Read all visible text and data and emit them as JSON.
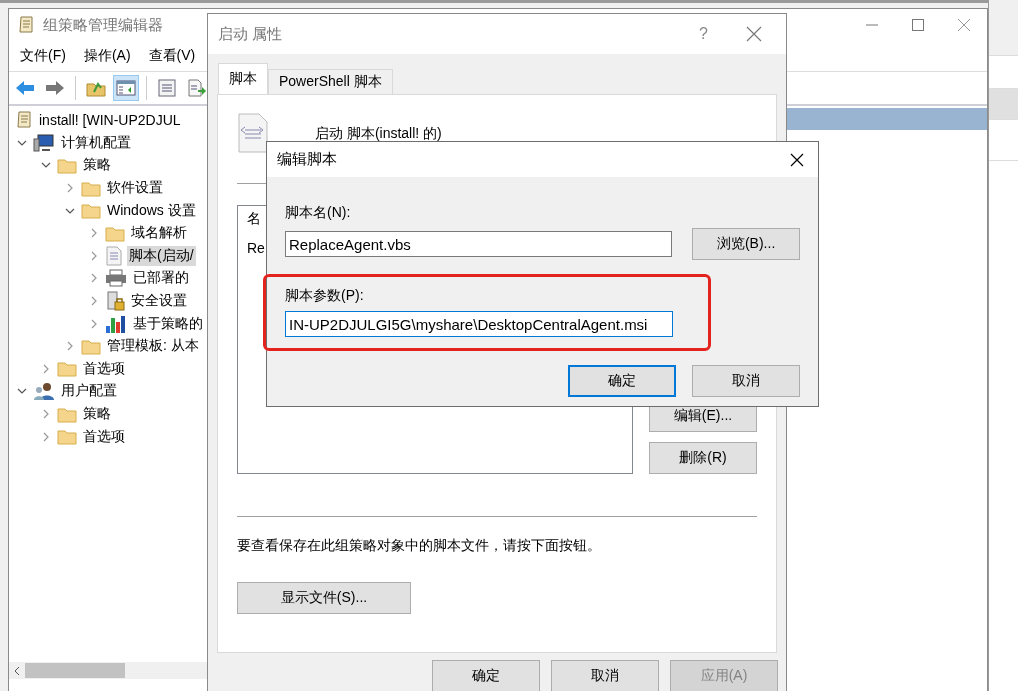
{
  "main_window": {
    "title": "组策略管理编辑器",
    "menu": [
      {
        "label": "文件(F)"
      },
      {
        "label": "操作(A)"
      },
      {
        "label": "查看(V)"
      }
    ],
    "toolbar": [
      {
        "kind": "back",
        "selected": false
      },
      {
        "kind": "forward",
        "selected": false
      },
      {
        "kind": "up",
        "selected": false
      },
      {
        "kind": "tree",
        "selected": true
      },
      {
        "kind": "properties",
        "selected": false
      },
      {
        "kind": "export",
        "selected": false
      }
    ],
    "tree": [
      {
        "label": "install!  [WIN-UP2DJUL",
        "kind": "gpo",
        "selected": false,
        "children": [
          {
            "label": "计算机配置",
            "kind": "computer",
            "selected": false,
            "expanded": true,
            "children": [
              {
                "label": "策略",
                "kind": "folder",
                "selected": false,
                "expanded": true,
                "children": [
                  {
                    "label": "软件设置",
                    "kind": "folder",
                    "selected": false,
                    "expanded": false
                  },
                  {
                    "label": "Windows 设置",
                    "kind": "folder",
                    "selected": false,
                    "expanded": true,
                    "children": [
                      {
                        "label": "域名解析",
                        "kind": "folder",
                        "selected": false,
                        "expanded": false
                      },
                      {
                        "label": "脚本(启动/",
                        "kind": "script",
                        "selected": true,
                        "expanded": false
                      },
                      {
                        "label": "已部署的",
                        "kind": "printer",
                        "selected": false,
                        "expanded": false
                      },
                      {
                        "label": "安全设置",
                        "kind": "security",
                        "selected": false,
                        "expanded": false
                      },
                      {
                        "label": "基于策略的",
                        "kind": "chart",
                        "selected": false,
                        "expanded": false
                      }
                    ]
                  },
                  {
                    "label": "管理模板: 从本",
                    "kind": "folder",
                    "selected": false,
                    "expanded": false
                  }
                ]
              },
              {
                "label": "首选项",
                "kind": "folder",
                "selected": false,
                "expanded": false
              }
            ]
          },
          {
            "label": "用户配置",
            "kind": "user",
            "selected": false,
            "expanded": true,
            "children": [
              {
                "label": "策略",
                "kind": "folder",
                "selected": false,
                "expanded": false
              },
              {
                "label": "首选项",
                "kind": "folder",
                "selected": false,
                "expanded": false
              }
            ]
          }
        ]
      }
    ]
  },
  "properties_dialog": {
    "title": "启动 属性",
    "help": "?",
    "tabs": [
      {
        "label": "脚本",
        "selected": true
      },
      {
        "label": "PowerShell 脚本",
        "selected": false
      }
    ],
    "heading": "启动 脚本(install! 的)",
    "list_header": "名",
    "list_rows": [
      "Re"
    ],
    "side_buttons": [
      {
        "label": "编辑(E)..."
      },
      {
        "label": "删除(R)"
      }
    ],
    "hint": "要查看保存在此组策略对象中的脚本文件，请按下面按钮。",
    "show_files_button": "显示文件(S)...",
    "buttons": [
      {
        "label": "确定",
        "disabled": false
      },
      {
        "label": "取消",
        "disabled": false
      },
      {
        "label": "应用(A)",
        "disabled": true
      }
    ]
  },
  "edit_dialog": {
    "title": "编辑脚本",
    "name_label": "脚本名(N):",
    "name_value": "ReplaceAgent.vbs",
    "browse_button": "浏览(B)...",
    "params_label": "脚本参数(P):",
    "params_value": "IN-UP2DJULGI5G\\myshare\\DesktopCentralAgent.msi",
    "params_highlighted": true,
    "buttons": [
      {
        "label": "确定",
        "default": true
      },
      {
        "label": "取消",
        "default": false
      }
    ]
  }
}
